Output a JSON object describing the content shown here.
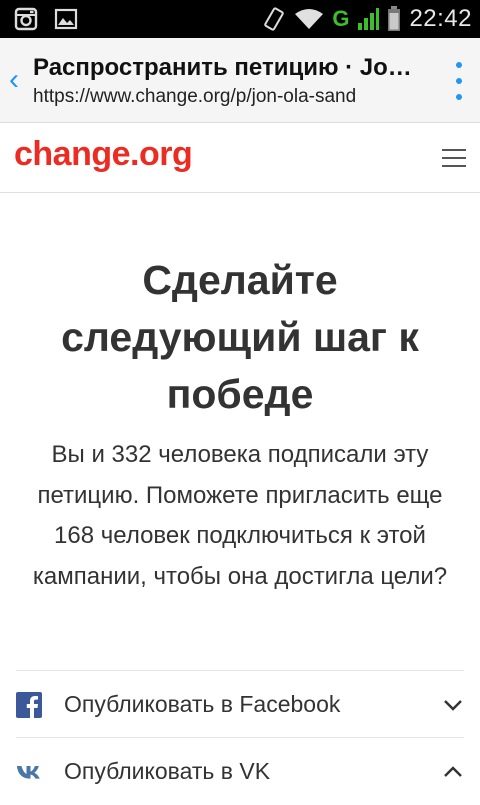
{
  "status_bar": {
    "time": "22:42",
    "network": "G",
    "icons": [
      "instagram-icon",
      "image-icon",
      "vibrate-icon",
      "wifi-icon",
      "signal-icon",
      "battery-icon"
    ]
  },
  "browser": {
    "title": "Распространить петицию · Jon-Ola Sand",
    "url": "https://www.change.org/p/jon-ola-sand",
    "accent": "#2196f3"
  },
  "site": {
    "logo": "change.org",
    "brand_color": "#ec2c22"
  },
  "content": {
    "headline": "Сделайте следующий шаг к победе",
    "body": "Вы и 332 человека подписали эту петицию. Поможете пригласить еще 168 человек подключиться к этой кампании, чтобы она достигла цели?"
  },
  "share": [
    {
      "label": "Опубликовать в Facebook",
      "icon": "facebook-icon",
      "state": "collapsed"
    },
    {
      "label": "Опубликовать в VK",
      "icon": "vk-icon",
      "state": "expanded"
    }
  ]
}
